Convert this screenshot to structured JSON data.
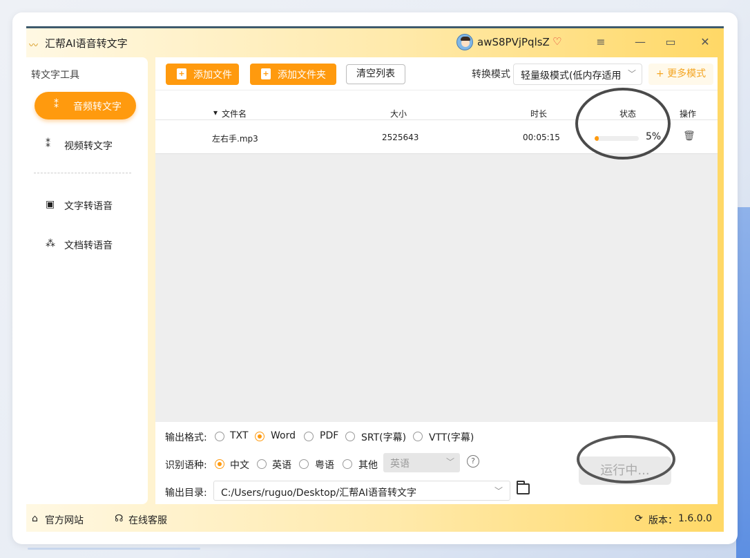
{
  "app": {
    "title": "汇帮AI语音转文字",
    "username": "awS8PVjPqlsZ",
    "window_buttons": [
      "≡",
      "—",
      "▭",
      "✕"
    ]
  },
  "sidebar": {
    "header": "转文字工具",
    "items": [
      {
        "label": "音频转文字",
        "icon": "audio-to-text-icon",
        "active": true
      },
      {
        "label": "视频转文字",
        "icon": "video-to-text-icon",
        "active": false
      },
      {
        "label": "文字转语音",
        "icon": "text-to-speech-icon",
        "active": false
      },
      {
        "label": "文档转语音",
        "icon": "document-to-speech-icon",
        "active": false
      }
    ]
  },
  "toolbar": {
    "add_file": "添加文件",
    "add_folder": "添加文件夹",
    "clear_list": "清空列表",
    "mode_label": "转换模式",
    "mode_value": "轻量级模式(低内存适用",
    "more_modes": "+ 更多模式"
  },
  "table": {
    "columns": [
      "文件名",
      "大小",
      "时长",
      "状态",
      "操作"
    ],
    "rows": [
      {
        "name": "左右手.mp3",
        "size": "2525643",
        "duration": "00:05:15",
        "progress": 5,
        "progress_text": "5%"
      }
    ]
  },
  "options": {
    "format_label": "输出格式:",
    "formats": [
      {
        "label": "TXT",
        "selected": false
      },
      {
        "label": "Word",
        "selected": true
      },
      {
        "label": "PDF",
        "selected": false
      },
      {
        "label": "SRT(字幕)",
        "selected": false
      },
      {
        "label": "VTT(字幕)",
        "selected": false
      }
    ],
    "lang_label": "识别语种:",
    "languages": [
      {
        "label": "中文",
        "selected": true
      },
      {
        "label": "英语",
        "selected": false
      },
      {
        "label": "粤语",
        "selected": false
      },
      {
        "label": "其他",
        "selected": false
      }
    ],
    "other_lang_value": "英语",
    "help": "?",
    "dir_label": "输出目录:",
    "dir_value": "C:/Users/ruguo/Desktop/汇帮AI语音转文字",
    "run_button": "运行中..."
  },
  "footer": {
    "website": "官方网站",
    "support": "在线客服",
    "version_label": "版本：",
    "version": "1.6.0.0"
  },
  "colors": {
    "accent": "#ff9a0e",
    "title_gradient_end": "#ffd866"
  }
}
